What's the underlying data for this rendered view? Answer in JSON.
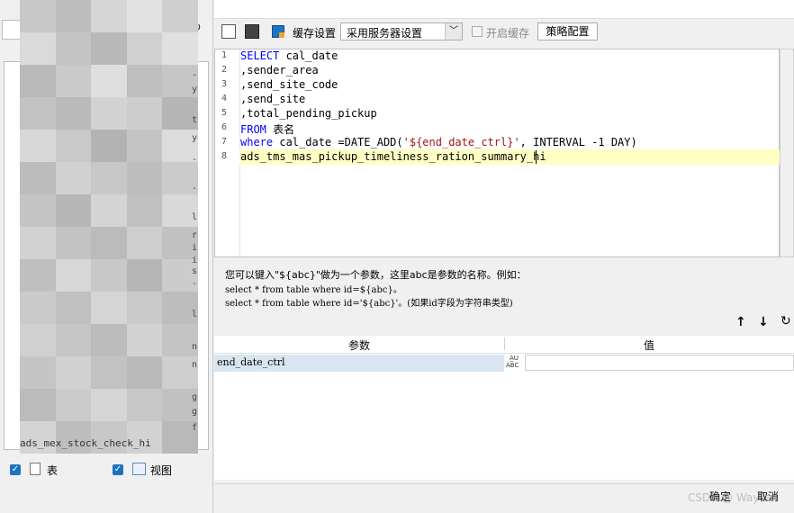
{
  "toolbar": {
    "cache_label": "缓存设置",
    "cache_select_value": "采用服务器设置",
    "enable_cache_label": "开启缓存",
    "strategy_button_label": "策略配置"
  },
  "editor": {
    "line_numbers": [
      "1",
      "2",
      "3",
      "4",
      "5",
      "6",
      "7",
      "8"
    ],
    "lines": [
      {
        "kw": "SELECT",
        "text": " cal_date"
      },
      {
        "kw": "",
        "text": ",sender_area"
      },
      {
        "kw": "",
        "text": ",send_site_code"
      },
      {
        "kw": "",
        "text": ",send_site"
      },
      {
        "kw": "",
        "text": ",total_pending_pickup"
      },
      {
        "kw": "FROM",
        "text": " 表名"
      },
      {
        "kw": "where",
        "text": " cal_date =DATE_ADD(",
        "str": "'${end_date_ctrl}'",
        "tail": ", INTERVAL -1 DAY)"
      },
      {
        "kw": "",
        "text": "ads_tms_mas_pickup_timeliness_ration_summary_hi"
      }
    ]
  },
  "help": {
    "line1": "您可以键入\"${abc}\"做为一个参数，这里abc是参数的名称。例如：",
    "line2": "select * from table where id=${abc}。",
    "line3": "select * from table where id='${abc}'。(如果id字段为字符串类型)"
  },
  "params": {
    "col_param": "参数",
    "col_value": "值",
    "rows": [
      {
        "name": "end_date_ctrl",
        "value": ""
      }
    ],
    "type_badge": "ABC"
  },
  "left_panel": {
    "tree_bottom_item": "ads_mex_stock_check_hi",
    "table_checkbox_label": "表",
    "view_checkbox_label": "视图",
    "edge_chars": [
      "-",
      "y",
      "t",
      "y",
      "-",
      "-",
      "l",
      "r",
      "i",
      "i",
      "s",
      "-",
      "l",
      "n",
      "n",
      "g",
      "g",
      "f"
    ]
  },
  "footer": {
    "ok_label": "确定",
    "cancel_label": "取消",
    "watermark": "CSDN @ Way1a"
  },
  "colors": {
    "keyword": "#0000ff",
    "string": "#a31515",
    "highlight_line": "#ffffc4",
    "param_row": "#d9e6f2",
    "checkbox": "#1e73be"
  }
}
